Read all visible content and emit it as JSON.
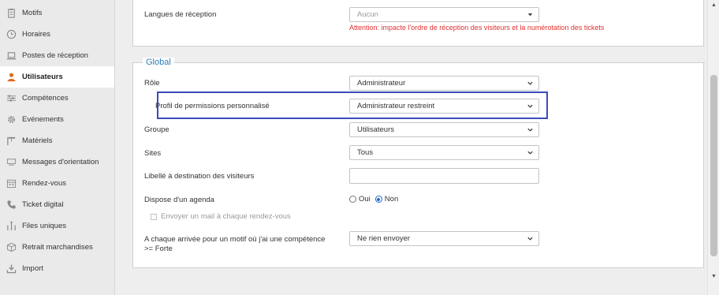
{
  "sidebar": {
    "items": [
      {
        "label": "Motifs",
        "icon": "clipboard-icon",
        "active": false
      },
      {
        "label": "Horaires",
        "icon": "clock-icon",
        "active": false
      },
      {
        "label": "Postes de réception",
        "icon": "laptop-icon",
        "active": false
      },
      {
        "label": "Utilisateurs",
        "icon": "user-icon",
        "active": true
      },
      {
        "label": "Compétences",
        "icon": "sliders-icon",
        "active": false
      },
      {
        "label": "Evénements",
        "icon": "gear-icon",
        "active": false
      },
      {
        "label": "Matériels",
        "icon": "projector-icon",
        "active": false
      },
      {
        "label": "Messages d'orientation",
        "icon": "message-icon",
        "active": false
      },
      {
        "label": "Rendez-vous",
        "icon": "calendar-icon",
        "active": false
      },
      {
        "label": "Ticket digital",
        "icon": "phone-icon",
        "active": false
      },
      {
        "label": "Files uniques",
        "icon": "queue-icon",
        "active": false
      },
      {
        "label": "Retrait marchandises",
        "icon": "package-icon",
        "active": false
      },
      {
        "label": "Import",
        "icon": "download-icon",
        "active": false
      }
    ]
  },
  "top_panel": {
    "langues_label": "Langues de réception",
    "langues_value": "Aucun",
    "warning": "Attention: impacte l'ordre de réception des visiteurs et la numérotation des tickets"
  },
  "global": {
    "legend": "Global",
    "role_label": "Rôle",
    "role_value": "Administrateur",
    "profil_label": "Profil de permissions personnalisé",
    "profil_value": "Administrateur restreint",
    "groupe_label": "Groupe",
    "groupe_value": "Utilisateurs",
    "sites_label": "Sites",
    "sites_value": "Tous",
    "libelle_label": "Libellé à destination des visiteurs",
    "libelle_value": "",
    "agenda_label": "Dispose d'un agenda",
    "agenda_oui": "Oui",
    "agenda_non": "Non",
    "agenda_selected": "Non",
    "mail_label": "Envoyer un mail à chaque rendez-vous",
    "arrivee_label_line1": "A chaque arrivée pour un motif où j'ai une compétence",
    "arrivee_label_line2": ">= Forte",
    "arrivee_value": "Ne rien envoyer"
  },
  "colors": {
    "accent": "#2d7cb8",
    "active_icon": "#e06c1f",
    "warning": "#e03030",
    "highlight_border": "#3b4bbb"
  }
}
